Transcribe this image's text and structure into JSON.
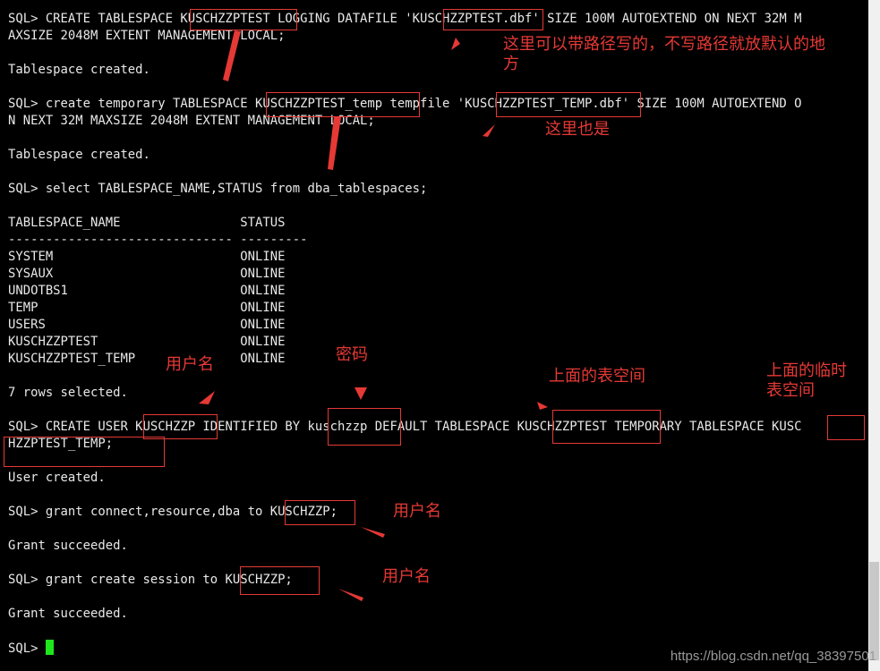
{
  "terminal": {
    "lines": [
      "SQL> CREATE TABLESPACE KUSCHZZPTEST LOGGING DATAFILE 'KUSCHZZPTEST.dbf' SIZE 100M AUTOEXTEND ON NEXT 32M M",
      "AXSIZE 2048M EXTENT MANAGEMENT LOCAL;",
      "",
      "Tablespace created.",
      "",
      "SQL> create temporary TABLESPACE KUSCHZZPTEST_temp tempfile 'KUSCHZZPTEST_TEMP.dbf' SIZE 100M AUTOEXTEND O",
      "N NEXT 32M MAXSIZE 2048M EXTENT MANAGEMENT LOCAL;",
      "",
      "Tablespace created.",
      "",
      "SQL> select TABLESPACE_NAME,STATUS from dba_tablespaces;",
      "",
      "TABLESPACE_NAME                STATUS",
      "------------------------------ ---------",
      "SYSTEM                         ONLINE",
      "SYSAUX                         ONLINE",
      "UNDOTBS1                       ONLINE",
      "TEMP                           ONLINE",
      "USERS                          ONLINE",
      "KUSCHZZPTEST                   ONLINE",
      "KUSCHZZPTEST_TEMP              ONLINE",
      "",
      "7 rows selected.",
      "",
      "SQL> CREATE USER KUSCHZZP IDENTIFIED BY kuschzzp DEFAULT TABLESPACE KUSCHZZPTEST TEMPORARY TABLESPACE KUSC",
      "HZZPTEST_TEMP;",
      "",
      "User created.",
      "",
      "SQL> grant connect,resource,dba to KUSCHZZP;",
      "",
      "Grant succeeded.",
      "",
      "SQL> grant create session to KUSCHZZP;",
      "",
      "Grant succeeded.",
      "",
      "SQL> "
    ]
  },
  "annotations": {
    "path_note": "这里可以带路径写的，不写路径就放默认的地\n方",
    "temp_note": "这里也是",
    "username_note_1": "用户名",
    "password_note": "密码",
    "tablespace_note": "上面的表空间",
    "temp_tablespace_note": "上面的临时\n表空间",
    "username_note_2": "用户名",
    "username_note_3": "用户名"
  },
  "watermark": "https://blog.csdn.net/qq_38397501",
  "colors": {
    "annotation": "#e53935",
    "cursor": "#1ee61e",
    "background": "#000000",
    "text": "#e8e8e8"
  }
}
